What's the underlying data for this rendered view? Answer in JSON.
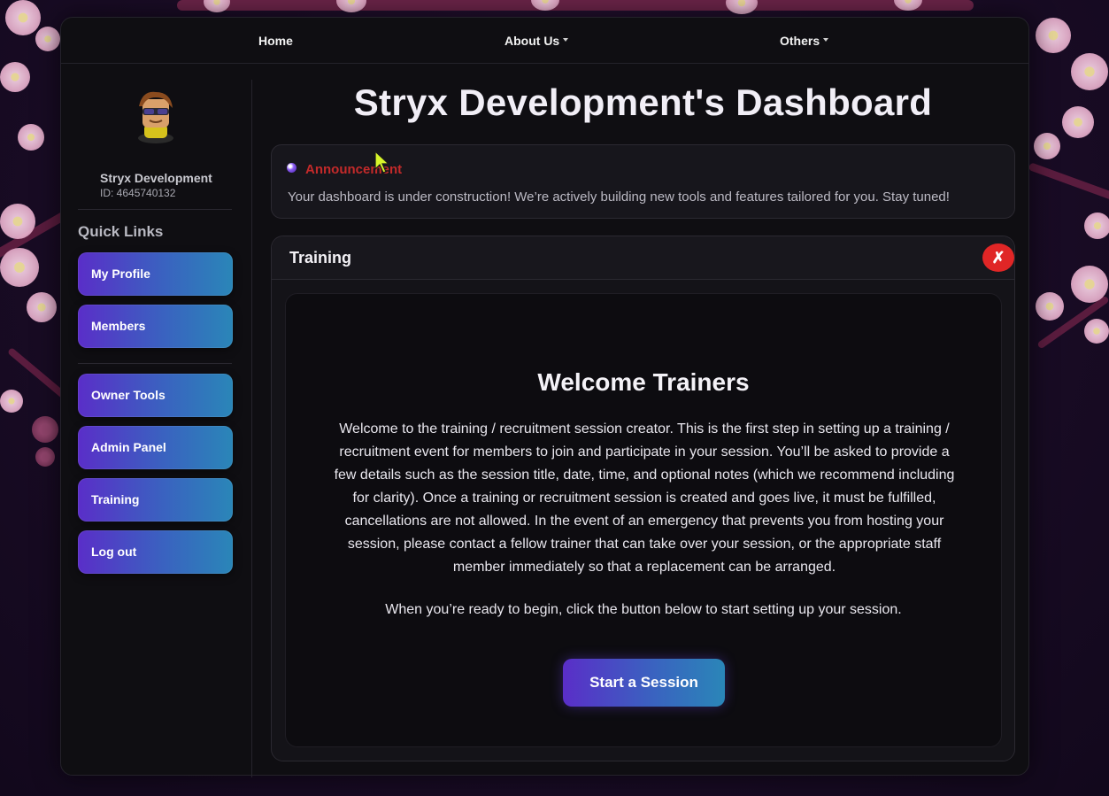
{
  "nav": {
    "home": "Home",
    "about": "About Us",
    "others": "Others"
  },
  "sidebar": {
    "user_name": "Stryx Development",
    "user_id": "ID: 4645740132",
    "quick_links_title": "Quick Links",
    "items": [
      {
        "label": "My Profile"
      },
      {
        "label": "Members"
      },
      {
        "label": "Owner Tools"
      },
      {
        "label": "Admin Panel"
      },
      {
        "label": "Training"
      },
      {
        "label": "Log out"
      }
    ]
  },
  "main": {
    "title": "Stryx Development's Dashboard",
    "announcement": {
      "title": "Announcement",
      "text": "Your dashboard is under construction! We’re actively building new tools and features tailored for you. Stay tuned!"
    },
    "training": {
      "title": "Training",
      "close_label": "✗",
      "welcome_title": "Welcome Trainers",
      "body": "Welcome to the training / recruitment session creator. This is the first step in setting up a training / recruitment event for members to join and participate in your session. You’ll be asked to provide a few details such as the session title, date, time, and optional notes (which we recommend including for clarity). Once a training or recruitment session is created and goes live, it must be fulfilled, cancellations are not allowed. In the event of an emergency that prevents you from hosting your session, please contact a fellow trainer that can take over your session, or the appropriate staff member immediately so that a replacement can be arranged.",
      "cta": "When you’re ready to begin, click the button below to start setting up your session.",
      "start_button": "Start a Session"
    }
  },
  "colors": {
    "accent_gradient_start": "#5a2ec8",
    "accent_gradient_end": "#2a86b8",
    "announcement_title": "#c42a2a",
    "close_button": "#e02626"
  }
}
